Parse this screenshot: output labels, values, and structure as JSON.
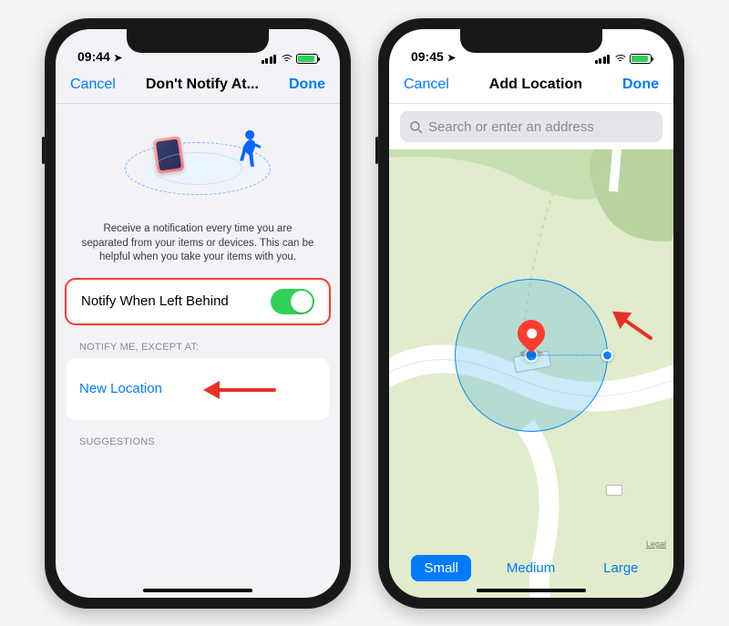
{
  "left": {
    "status": {
      "time": "09:44"
    },
    "nav": {
      "cancel": "Cancel",
      "title": "Don't Notify At...",
      "done": "Done"
    },
    "description": "Receive a notification every time you are separated from your items or devices. This can be helpful when you take your items with you.",
    "toggle_row": {
      "label": "Notify When Left Behind",
      "on": true
    },
    "section1": "NOTIFY ME, EXCEPT AT:",
    "new_location": "New Location",
    "section2": "SUGGESTIONS"
  },
  "right": {
    "status": {
      "time": "09:45"
    },
    "nav": {
      "cancel": "Cancel",
      "title": "Add Location",
      "done": "Done"
    },
    "search_placeholder": "Search or enter an address",
    "legal": "Legal",
    "segments": {
      "small": "Small",
      "medium": "Medium",
      "large": "Large",
      "selected": "small"
    }
  }
}
